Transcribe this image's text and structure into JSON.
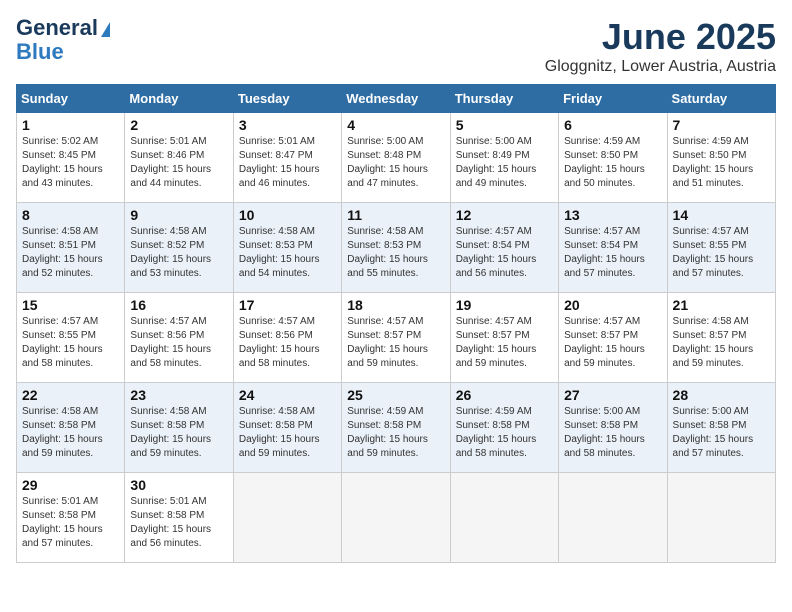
{
  "logo": {
    "line1": "General",
    "line2": "Blue"
  },
  "title": "June 2025",
  "location": "Gloggnitz, Lower Austria, Austria",
  "weekdays": [
    "Sunday",
    "Monday",
    "Tuesday",
    "Wednesday",
    "Thursday",
    "Friday",
    "Saturday"
  ],
  "weeks": [
    [
      {
        "day": 1,
        "sunrise": "5:02 AM",
        "sunset": "8:45 PM",
        "daylight": "15 hours and 43 minutes."
      },
      {
        "day": 2,
        "sunrise": "5:01 AM",
        "sunset": "8:46 PM",
        "daylight": "15 hours and 44 minutes."
      },
      {
        "day": 3,
        "sunrise": "5:01 AM",
        "sunset": "8:47 PM",
        "daylight": "15 hours and 46 minutes."
      },
      {
        "day": 4,
        "sunrise": "5:00 AM",
        "sunset": "8:48 PM",
        "daylight": "15 hours and 47 minutes."
      },
      {
        "day": 5,
        "sunrise": "5:00 AM",
        "sunset": "8:49 PM",
        "daylight": "15 hours and 49 minutes."
      },
      {
        "day": 6,
        "sunrise": "4:59 AM",
        "sunset": "8:50 PM",
        "daylight": "15 hours and 50 minutes."
      },
      {
        "day": 7,
        "sunrise": "4:59 AM",
        "sunset": "8:50 PM",
        "daylight": "15 hours and 51 minutes."
      }
    ],
    [
      {
        "day": 8,
        "sunrise": "4:58 AM",
        "sunset": "8:51 PM",
        "daylight": "15 hours and 52 minutes."
      },
      {
        "day": 9,
        "sunrise": "4:58 AM",
        "sunset": "8:52 PM",
        "daylight": "15 hours and 53 minutes."
      },
      {
        "day": 10,
        "sunrise": "4:58 AM",
        "sunset": "8:53 PM",
        "daylight": "15 hours and 54 minutes."
      },
      {
        "day": 11,
        "sunrise": "4:58 AM",
        "sunset": "8:53 PM",
        "daylight": "15 hours and 55 minutes."
      },
      {
        "day": 12,
        "sunrise": "4:57 AM",
        "sunset": "8:54 PM",
        "daylight": "15 hours and 56 minutes."
      },
      {
        "day": 13,
        "sunrise": "4:57 AM",
        "sunset": "8:54 PM",
        "daylight": "15 hours and 57 minutes."
      },
      {
        "day": 14,
        "sunrise": "4:57 AM",
        "sunset": "8:55 PM",
        "daylight": "15 hours and 57 minutes."
      }
    ],
    [
      {
        "day": 15,
        "sunrise": "4:57 AM",
        "sunset": "8:55 PM",
        "daylight": "15 hours and 58 minutes."
      },
      {
        "day": 16,
        "sunrise": "4:57 AM",
        "sunset": "8:56 PM",
        "daylight": "15 hours and 58 minutes."
      },
      {
        "day": 17,
        "sunrise": "4:57 AM",
        "sunset": "8:56 PM",
        "daylight": "15 hours and 58 minutes."
      },
      {
        "day": 18,
        "sunrise": "4:57 AM",
        "sunset": "8:57 PM",
        "daylight": "15 hours and 59 minutes."
      },
      {
        "day": 19,
        "sunrise": "4:57 AM",
        "sunset": "8:57 PM",
        "daylight": "15 hours and 59 minutes."
      },
      {
        "day": 20,
        "sunrise": "4:57 AM",
        "sunset": "8:57 PM",
        "daylight": "15 hours and 59 minutes."
      },
      {
        "day": 21,
        "sunrise": "4:58 AM",
        "sunset": "8:57 PM",
        "daylight": "15 hours and 59 minutes."
      }
    ],
    [
      {
        "day": 22,
        "sunrise": "4:58 AM",
        "sunset": "8:58 PM",
        "daylight": "15 hours and 59 minutes."
      },
      {
        "day": 23,
        "sunrise": "4:58 AM",
        "sunset": "8:58 PM",
        "daylight": "15 hours and 59 minutes."
      },
      {
        "day": 24,
        "sunrise": "4:58 AM",
        "sunset": "8:58 PM",
        "daylight": "15 hours and 59 minutes."
      },
      {
        "day": 25,
        "sunrise": "4:59 AM",
        "sunset": "8:58 PM",
        "daylight": "15 hours and 59 minutes."
      },
      {
        "day": 26,
        "sunrise": "4:59 AM",
        "sunset": "8:58 PM",
        "daylight": "15 hours and 58 minutes."
      },
      {
        "day": 27,
        "sunrise": "5:00 AM",
        "sunset": "8:58 PM",
        "daylight": "15 hours and 58 minutes."
      },
      {
        "day": 28,
        "sunrise": "5:00 AM",
        "sunset": "8:58 PM",
        "daylight": "15 hours and 57 minutes."
      }
    ],
    [
      {
        "day": 29,
        "sunrise": "5:01 AM",
        "sunset": "8:58 PM",
        "daylight": "15 hours and 57 minutes."
      },
      {
        "day": 30,
        "sunrise": "5:01 AM",
        "sunset": "8:58 PM",
        "daylight": "15 hours and 56 minutes."
      },
      null,
      null,
      null,
      null,
      null
    ]
  ],
  "labels": {
    "sunrise": "Sunrise:",
    "sunset": "Sunset:",
    "daylight": "Daylight:"
  }
}
